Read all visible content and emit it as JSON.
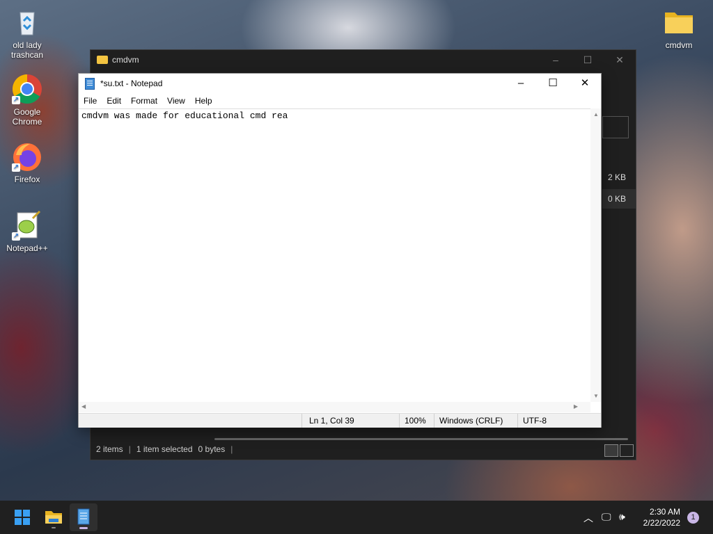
{
  "desktop": {
    "icons": [
      {
        "label_line1": "old lady",
        "label_line2": "trashcan"
      },
      {
        "label_line1": "Google",
        "label_line2": "Chrome"
      },
      {
        "label_line1": "Firefox",
        "label_line2": ""
      },
      {
        "label_line1": "Notepad++",
        "label_line2": ""
      },
      {
        "label_line1": "cmdvm",
        "label_line2": ""
      }
    ]
  },
  "explorer": {
    "title": "cmdvm",
    "sizes": [
      "2 KB",
      "0 KB"
    ],
    "status": {
      "items": "2 items",
      "selected": "1 item selected",
      "bytes": "0 bytes"
    }
  },
  "notepad": {
    "title": "*su.txt - Notepad",
    "menu": [
      "File",
      "Edit",
      "Format",
      "View",
      "Help"
    ],
    "content": "cmdvm was made for educational cmd rea",
    "status": {
      "position": "Ln 1, Col 39",
      "zoom": "100%",
      "line_ending": "Windows (CRLF)",
      "encoding": "UTF-8"
    }
  },
  "taskbar": {
    "time": "2:30 AM",
    "date": "2/22/2022",
    "notification_count": "1"
  },
  "colors": {
    "taskbar_bg": "#202020",
    "explorer_bg": "#1f1f1f",
    "folder_yellow": "#f4c542",
    "notification_badge": "#c9b6e6"
  }
}
